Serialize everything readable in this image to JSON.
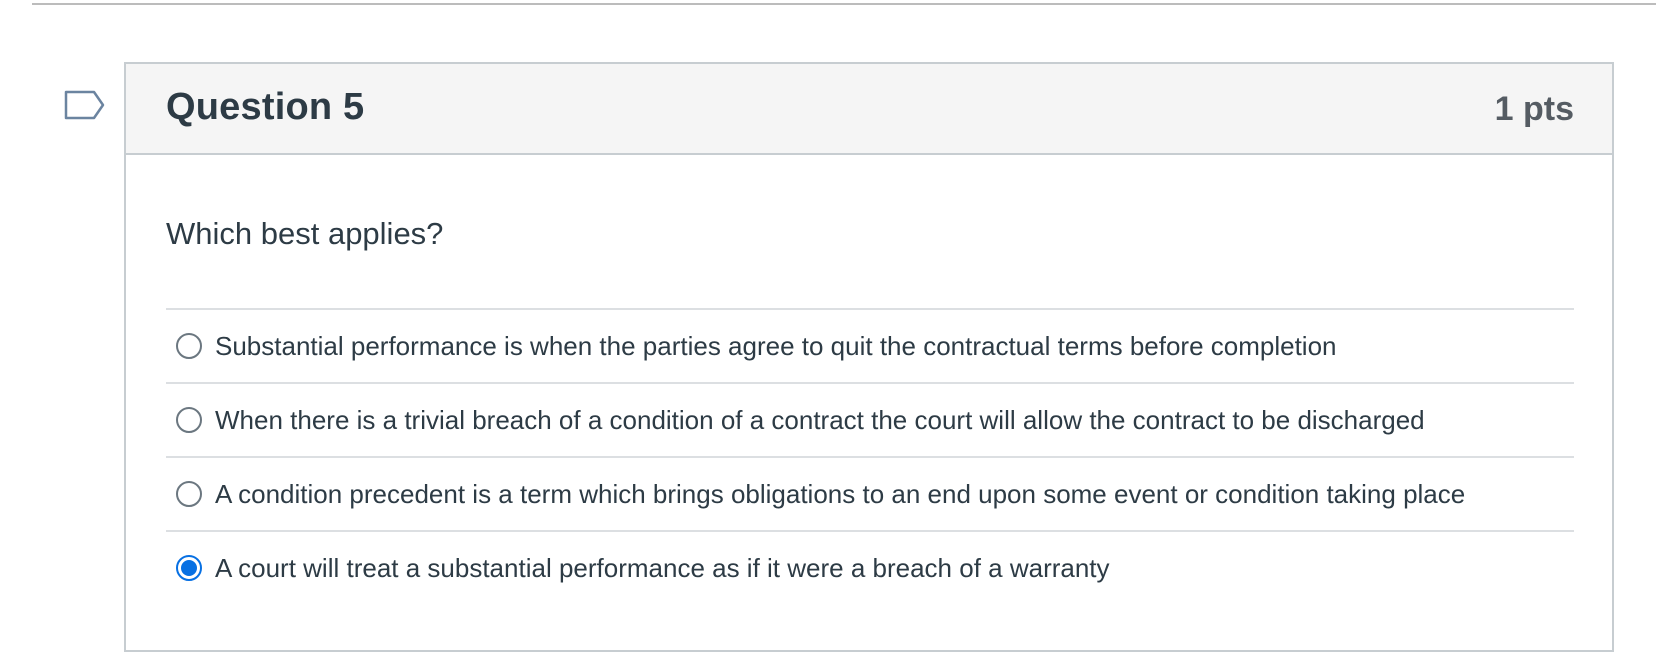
{
  "question": {
    "title": "Question 5",
    "points": "1 pts",
    "text": "Which best applies?"
  },
  "answers": [
    {
      "label": "Substantial performance is when the parties agree to quit the contractual terms before completion",
      "selected": false
    },
    {
      "label": "When there is a trivial breach of a condition of a contract the court will allow the contract to be discharged",
      "selected": false
    },
    {
      "label": "A condition precedent is a term which brings obligations to an end upon some event or condition taking place",
      "selected": false
    },
    {
      "label": "A court will treat a substantial performance as if it were a breach of a warranty",
      "selected": true
    }
  ],
  "colors": {
    "accent": "#0770e3",
    "header_bg": "#f5f5f5",
    "border": "#c7cdd1",
    "text": "#2d3b45"
  },
  "icons": {
    "flag": "flag-question-icon"
  }
}
